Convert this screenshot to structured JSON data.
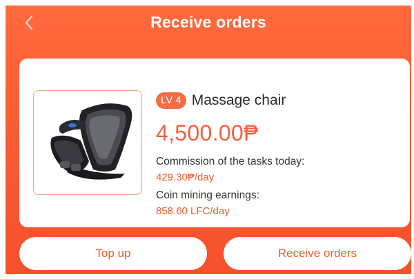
{
  "header": {
    "title": "Receive orders",
    "back_icon": "chevron-left-icon"
  },
  "product": {
    "level_badge": "LV 4",
    "name": "Massage chair",
    "price": "4,500.00₱",
    "image_icon": "massage-chair-icon",
    "commission_label": "Commission of the tasks today:",
    "commission_value": "429.30₱/day",
    "mining_label": "Coin mining earnings:",
    "mining_value": "858.60 LFC/day"
  },
  "actions": {
    "top_up_label": "Top up",
    "receive_orders_label": "Receive orders"
  },
  "colors": {
    "accent": "#f85c34",
    "badge": "#f46c43",
    "price": "#f45f3a"
  }
}
